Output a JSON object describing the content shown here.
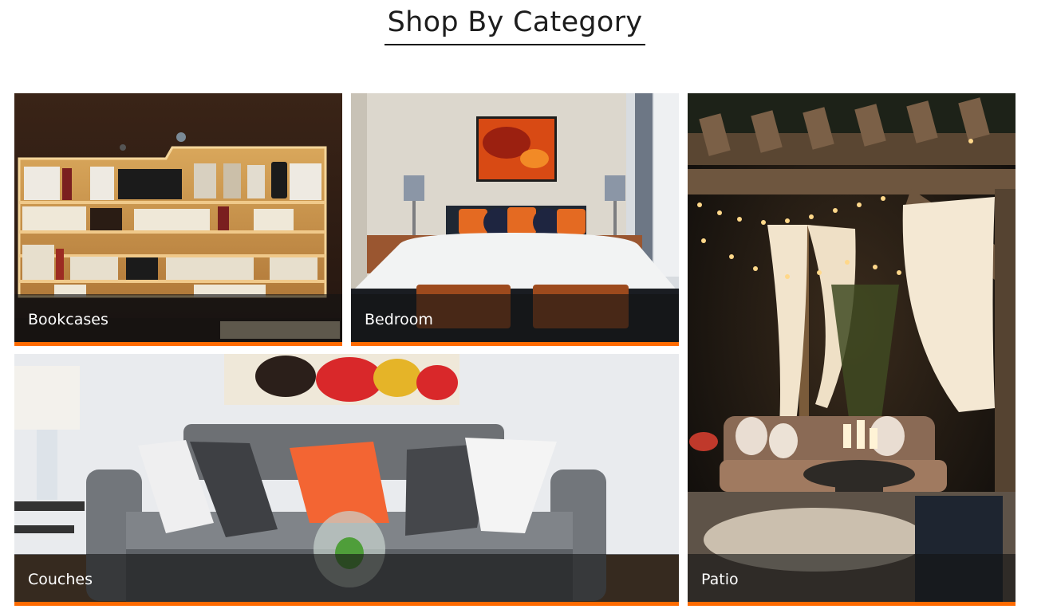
{
  "section": {
    "title": "Shop By Category"
  },
  "categories": [
    {
      "label": "Bookcases"
    },
    {
      "label": "Bedroom"
    },
    {
      "label": "Couches"
    },
    {
      "label": "Patio"
    }
  ],
  "colors": {
    "accent": "#ff6a00",
    "caption_overlay": "#141414",
    "caption_text": "#ffffff",
    "title_text": "#1d1d1d"
  }
}
